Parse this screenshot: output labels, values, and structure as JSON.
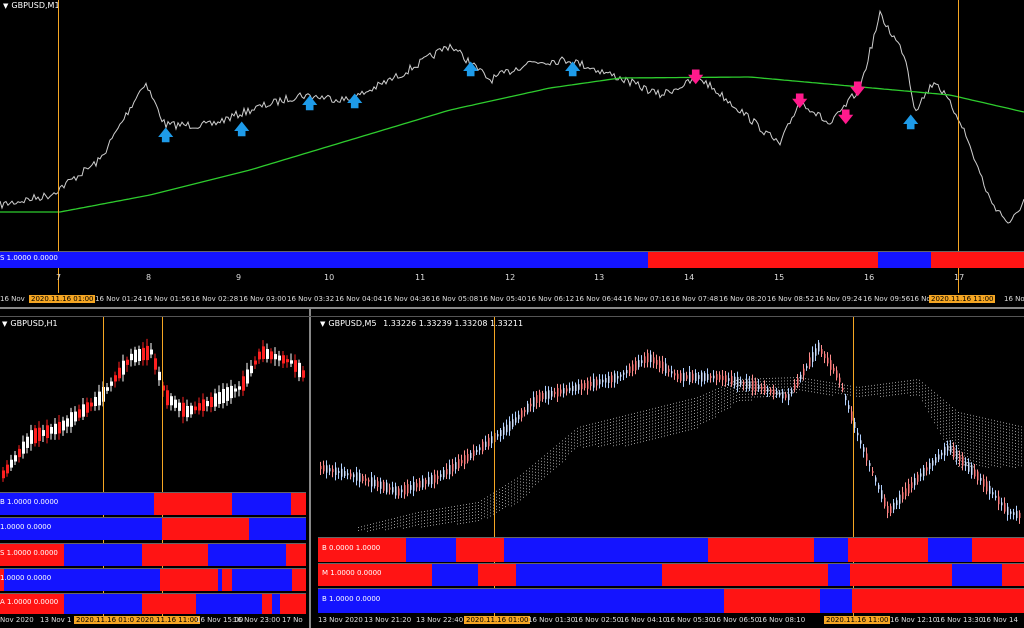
{
  "top_chart": {
    "title": "GBPUSD,M1",
    "strip_label": "S 1.0000 0.0000",
    "session_numbers": [
      "7",
      "8",
      "9",
      "10",
      "11",
      "12",
      "13",
      "14",
      "15",
      "16",
      "17"
    ],
    "time_labels": [
      "16 Nov",
      "2020.11.16 01:00",
      "16 Nov 01:24",
      "16 Nov 01:56",
      "16 Nov 02:28",
      "16 Nov 03:00",
      "16 Nov 03:32",
      "16 Nov 04:04",
      "16 Nov 04:36",
      "16 Nov 05:08",
      "16 Nov 05:40",
      "16 Nov 06:12",
      "16 Nov 06:44",
      "16 Nov 07:16",
      "16 Nov 07:48",
      "16 Nov 08:20",
      "16 Nov 08:52",
      "16 Nov 09:24",
      "16 Nov 09:56",
      "16 No",
      "2020.11.16 11:00",
      "16 Nov"
    ],
    "colors": {
      "price": "#cfcfcf",
      "ma": "#2ecc2e",
      "up_arrow": "#1e9be9",
      "down_arrow": "#ff1a8c",
      "bull": "#1414ff",
      "bear": "#ff1414",
      "marker": "#f5a623"
    }
  },
  "bottom_left": {
    "title": "GBPUSD,H1",
    "strips": [
      {
        "label": "B 1.0000 0.0000"
      },
      {
        "label": "1.0000 0.0000"
      },
      {
        "label": "S 1.0000 0.0000"
      },
      {
        "label": "1.0000 0.0000"
      },
      {
        "label": "A 1.0000 0.0000"
      }
    ],
    "time_labels": [
      "Nov 2020",
      "13 Nov 1",
      "2020.11.16 01:00",
      "2020.11.16 11:00",
      "16 Nov 15:00",
      "16 Nov 23:00",
      "17 No"
    ]
  },
  "bottom_right": {
    "title": "GBPUSD,M5",
    "ohlc": "1.33226 1.33239 1.33208 1.33211",
    "strips": [
      {
        "label": "B 0.0000 1.0000"
      },
      {
        "label": "M 1.0000 0.0000"
      },
      {
        "label": "B 1.0000 0.0000"
      }
    ],
    "time_labels": [
      "13 Nov 2020",
      "13 Nov 21:20",
      "13 Nov 22:40",
      "2020.11.16 01:00",
      "16 Nov 01:30",
      "16 Nov 02:50",
      "16 Nov 04:10",
      "16 Nov 05:30",
      "16 Nov 06:50",
      "16 Nov 08:10",
      "2020.11.16 11:00",
      "16 Nov 12:10",
      "16 Nov 13:30",
      "16 Nov 14"
    ]
  }
}
